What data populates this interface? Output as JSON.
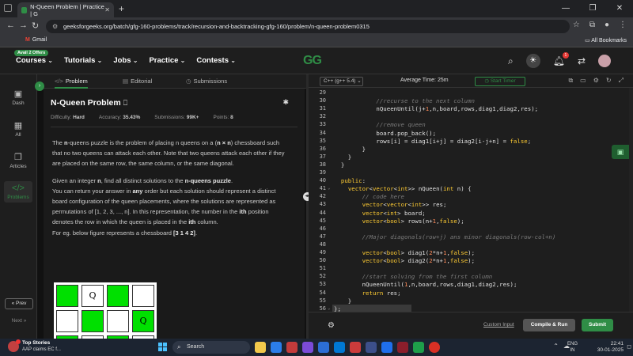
{
  "browser": {
    "tab_title": "N-Queen Problem | Practice | G",
    "new_tab": "+",
    "url": "geeksforgeeks.org/batch/gfg-160-problems/track/recursion-and-backtracking-gfg-160/problem/n-queen-problem0315",
    "bookmark_gmail": "Gmail",
    "all_bookmarks": "All Bookmarks"
  },
  "site": {
    "promo": "Avail 2 Offers",
    "nav": [
      "Courses",
      "Tutorials",
      "Jobs",
      "Practice",
      "Contests"
    ],
    "logo": "GG",
    "bell_count": "1"
  },
  "rail": {
    "items": [
      {
        "label": "Dash",
        "icon": "dashboard-icon"
      },
      {
        "label": "All",
        "icon": "grid-icon"
      },
      {
        "label": "Articles",
        "icon": "book-icon"
      },
      {
        "label": "Problems",
        "icon": "code-icon"
      }
    ],
    "prev": "« Prev",
    "next": "Next »"
  },
  "problem_tabs": [
    "Problem",
    "Editorial",
    "Submissions"
  ],
  "problem": {
    "title": "N-Queen Problem",
    "difficulty_label": "Difficulty:",
    "difficulty": "Hard",
    "accuracy_label": "Accuracy:",
    "accuracy": "35.43%",
    "submissions_label": "Submissions:",
    "submissions": "99K+",
    "points_label": "Points:",
    "points": "8",
    "p1": [
      "The ",
      "n",
      "-queens puzzle is the problem of placing n queens on a (",
      "n × n",
      ") chessboard such that no two queens can attack each other. Note that two queens attack each other if they are placed on the same row, the same column, or the same diagonal."
    ],
    "p2": [
      "Given an integer ",
      "n",
      ", find all distinct solutions to the ",
      "n-queens puzzle",
      "."
    ],
    "p3": [
      "You can return your answer in ",
      "any",
      " order but each solution should represent a distinct board configuration of the queen placements, where the solutions are represented as permutations of [1, 2, 3, ..., n]. In this representation, the number in the ",
      "ith",
      " position denotes the row in which the queen is placed in the ",
      "ith",
      " column."
    ],
    "p4": [
      "For eg. below figure represents a chessboard ",
      "[3 1 4 2]",
      "."
    ],
    "board_rows": [
      [
        "",
        "Q",
        "",
        ""
      ],
      [
        "",
        "",
        "",
        "Q"
      ],
      [
        "Q",
        "",
        "",
        ""
      ]
    ],
    "board_colors": [
      [
        "g",
        "w",
        "g",
        "w"
      ],
      [
        "w",
        "g",
        "w",
        "g"
      ],
      [
        "g",
        "w",
        "g",
        "w"
      ]
    ]
  },
  "editor": {
    "language": "C++ (g++ 5.4)",
    "avg_time": "Average Time: 25m",
    "timer": "Start Timer",
    "lines": [
      {
        "n": "29",
        "code": []
      },
      {
        "n": "30",
        "code": [
          [
            "cm",
            "            //recurse to the next column"
          ]
        ]
      },
      {
        "n": "31",
        "code": [
          [
            "",
            "            nQueenUntil(j+"
          ],
          [
            "nm",
            "1"
          ],
          [
            "",
            ",n,board,rows,diag1,diag2,res);"
          ]
        ]
      },
      {
        "n": "32",
        "code": []
      },
      {
        "n": "33",
        "code": [
          [
            "cm",
            "            //remove queen"
          ]
        ]
      },
      {
        "n": "34",
        "code": [
          [
            "",
            "            board.pop_back();"
          ]
        ]
      },
      {
        "n": "35",
        "code": [
          [
            "",
            "            rows[i] = diag1[i+j] = diag2[i-j+n] = "
          ],
          [
            "kw",
            "false"
          ],
          [
            "",
            ";"
          ]
        ]
      },
      {
        "n": "36",
        "code": [
          [
            "",
            "        }"
          ]
        ]
      },
      {
        "n": "37",
        "code": [
          [
            "",
            "    }"
          ]
        ]
      },
      {
        "n": "38",
        "code": [
          [
            "",
            "  }"
          ]
        ]
      },
      {
        "n": "39",
        "code": []
      },
      {
        "n": "40",
        "code": [
          [
            "kw",
            "  public"
          ],
          [
            "",
            ":"
          ]
        ]
      },
      {
        "n": "41",
        "code": [
          [
            "",
            "    "
          ],
          [
            "ty",
            "vector"
          ],
          [
            "",
            "<"
          ],
          [
            "ty",
            "vector"
          ],
          [
            "",
            "<"
          ],
          [
            "ty",
            "int"
          ],
          [
            "",
            ">> nQueen("
          ],
          [
            "ty",
            "int"
          ],
          [
            "",
            " n) {"
          ]
        ]
      },
      {
        "n": "42",
        "code": [
          [
            "cm",
            "        // code here"
          ]
        ]
      },
      {
        "n": "43",
        "code": [
          [
            "",
            "        "
          ],
          [
            "ty",
            "vector"
          ],
          [
            "",
            "<"
          ],
          [
            "ty",
            "vector"
          ],
          [
            "",
            "<"
          ],
          [
            "ty",
            "int"
          ],
          [
            "",
            ">> res;"
          ]
        ]
      },
      {
        "n": "44",
        "code": [
          [
            "",
            "        "
          ],
          [
            "ty",
            "vector"
          ],
          [
            "",
            "<"
          ],
          [
            "ty",
            "int"
          ],
          [
            "",
            "> board;"
          ]
        ]
      },
      {
        "n": "45",
        "code": [
          [
            "",
            "        "
          ],
          [
            "ty",
            "vector"
          ],
          [
            "",
            "<"
          ],
          [
            "ty",
            "bool"
          ],
          [
            "",
            "> rows(n+"
          ],
          [
            "nm",
            "1"
          ],
          [
            "",
            ","
          ],
          [
            "kw",
            "false"
          ],
          [
            "",
            ");"
          ]
        ]
      },
      {
        "n": "46",
        "code": []
      },
      {
        "n": "47",
        "code": [
          [
            "cm",
            "        //Major diagonals(row+j) ans minor diagonals(row-col+n)"
          ]
        ]
      },
      {
        "n": "48",
        "code": []
      },
      {
        "n": "49",
        "code": [
          [
            "",
            "        "
          ],
          [
            "ty",
            "vector"
          ],
          [
            "",
            "<"
          ],
          [
            "ty",
            "bool"
          ],
          [
            "",
            "> diag1("
          ],
          [
            "nm",
            "2"
          ],
          [
            "",
            "*n+"
          ],
          [
            "nm",
            "1"
          ],
          [
            "",
            ","
          ],
          [
            "kw",
            "false"
          ],
          [
            "",
            ");"
          ]
        ]
      },
      {
        "n": "50",
        "code": [
          [
            "",
            "        "
          ],
          [
            "ty",
            "vector"
          ],
          [
            "",
            "<"
          ],
          [
            "ty",
            "bool"
          ],
          [
            "",
            "> diag2("
          ],
          [
            "nm",
            "2"
          ],
          [
            "",
            "*n+"
          ],
          [
            "nm",
            "1"
          ],
          [
            "",
            ","
          ],
          [
            "kw",
            "false"
          ],
          [
            "",
            ");"
          ]
        ]
      },
      {
        "n": "51",
        "code": []
      },
      {
        "n": "52",
        "code": [
          [
            "cm",
            "        //start solving from the first column"
          ]
        ]
      },
      {
        "n": "53",
        "code": [
          [
            "",
            "        nQueenUntil("
          ],
          [
            "nm",
            "1"
          ],
          [
            "",
            ",n,board,rows,diag1,diag2,res);"
          ]
        ]
      },
      {
        "n": "54",
        "code": [
          [
            "",
            "        "
          ],
          [
            "kw",
            "return"
          ],
          [
            "",
            " res;"
          ]
        ]
      },
      {
        "n": "55",
        "code": [
          [
            "",
            "    }"
          ]
        ]
      },
      {
        "n": "56",
        "code": [
          [
            "",
            "};"
          ]
        ]
      },
      {
        "n": "57",
        "code": [
          [
            "cm",
            "// } Driver Code Ends"
          ]
        ]
      }
    ],
    "fold_lines": [
      "41",
      "56",
      "57"
    ],
    "custom_input": "Custom Input",
    "compile_run": "Compile & Run",
    "submit": "Submit"
  },
  "taskbar": {
    "weather_title": "Top Stories",
    "weather_sub": "AAP claims EC f...",
    "search": "Search",
    "lang1": "ENG",
    "lang2": "IN",
    "time": "22:41",
    "date": "30-01-2025",
    "app_colors": [
      "#f2c94c",
      "#2b7de9",
      "#c43b3b",
      "#7b4bd8",
      "#2c6ed5",
      "#0078d4",
      "#cc3b3b",
      "#3c4f8a",
      "#1f6feb",
      "#8b1e2b",
      "#1e9e4a",
      "#d93025"
    ]
  }
}
